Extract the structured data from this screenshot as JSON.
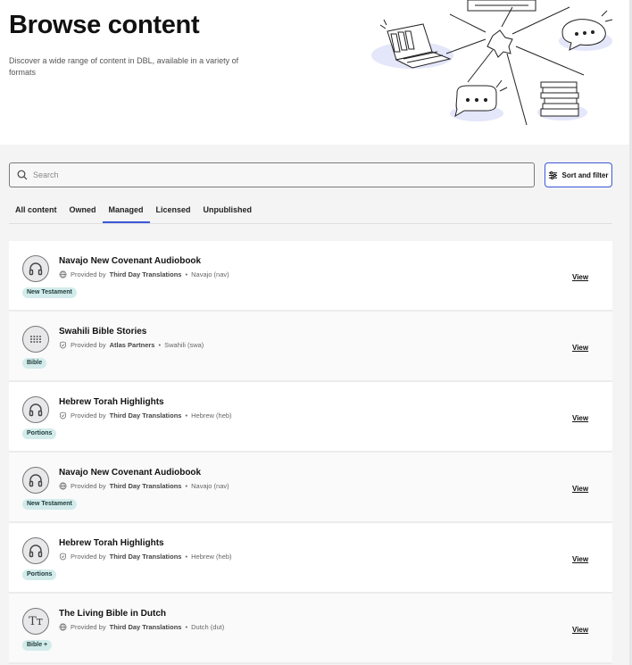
{
  "header": {
    "title": "Browse content",
    "description": "Discover a wide range of content in DBL, available in a variety of formats"
  },
  "search": {
    "placeholder": "Search",
    "value": ""
  },
  "sort_filter": {
    "label": "Sort and filter"
  },
  "tabs": [
    {
      "label": "All content",
      "active": false
    },
    {
      "label": "Owned",
      "active": false
    },
    {
      "label": "Managed",
      "active": true
    },
    {
      "label": "Licensed",
      "active": false
    },
    {
      "label": "Unpublished",
      "active": false
    }
  ],
  "items": [
    {
      "title": "Navajo New Covenant Audiobook",
      "provided_prefix": "Provided by",
      "provider": "Third Day Translations",
      "language": "Navajo (nav)",
      "badge": "New Testament",
      "view": "View",
      "icon": "headphones-icon",
      "meta_icon": "globe-icon"
    },
    {
      "title": "Swahili Bible Stories",
      "provided_prefix": "Provided by",
      "provider": "Atlas Partners",
      "language": "Swahili (swa)",
      "badge": "Bible",
      "view": "View",
      "icon": "braille-icon",
      "meta_icon": "shield-check-icon"
    },
    {
      "title": "Hebrew Torah Highlights",
      "provided_prefix": "Provided by",
      "provider": "Third Day Translations",
      "language": "Hebrew (heb)",
      "badge": "Portions",
      "view": "View",
      "icon": "headphones-icon",
      "meta_icon": "shield-check-icon"
    },
    {
      "title": "Navajo New Covenant Audiobook",
      "provided_prefix": "Provided by",
      "provider": "Third Day Translations",
      "language": "Navajo (nav)",
      "badge": "New Testament",
      "view": "View",
      "icon": "headphones-icon",
      "meta_icon": "globe-icon"
    },
    {
      "title": "Hebrew Torah Highlights",
      "provided_prefix": "Provided by",
      "provider": "Third Day Translations",
      "language": "Hebrew (heb)",
      "badge": "Portions",
      "view": "View",
      "icon": "headphones-icon",
      "meta_icon": "shield-check-icon"
    },
    {
      "title": "The Living Bible in Dutch",
      "provided_prefix": "Provided by",
      "provider": "Third Day Translations",
      "language": "Dutch (dut)",
      "badge": "Bible +",
      "view": "View",
      "icon": "text-icon",
      "icon_text": "Tт",
      "meta_icon": "globe-icon"
    }
  ],
  "colors": {
    "accent": "#3b57d9",
    "badge_bg": "#d3ebeb",
    "illustration_blob": "#e4e6fa"
  }
}
